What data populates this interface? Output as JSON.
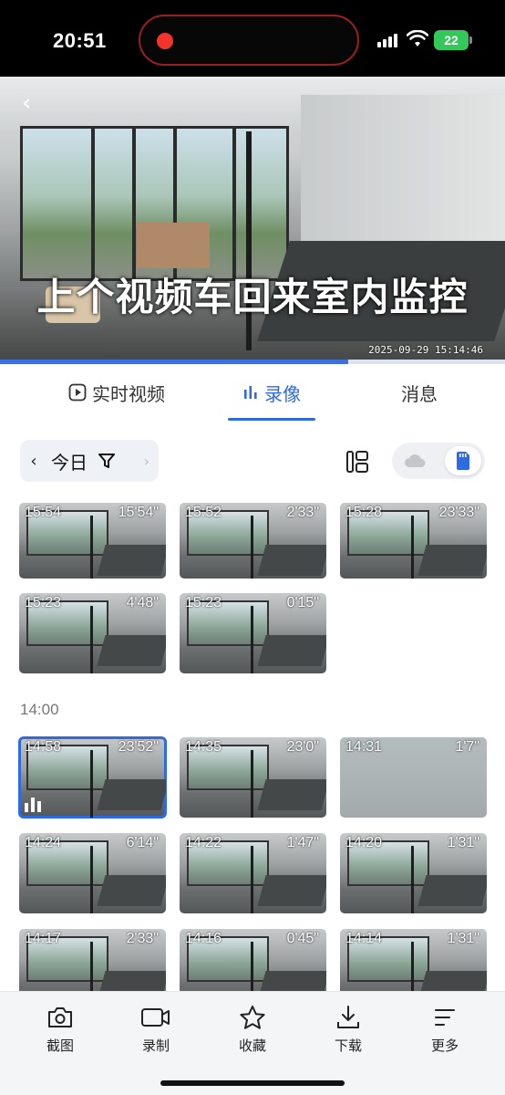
{
  "status_bar": {
    "time": "20:51",
    "battery": "22"
  },
  "video": {
    "overlay_text": "上个视频车回来室内监控",
    "timestamp": "2025-09-29 15:14:46",
    "progress": 0.69
  },
  "tabs": [
    {
      "label": "实时视频",
      "active": false
    },
    {
      "label": "录像",
      "active": true
    },
    {
      "label": "消息",
      "active": false
    }
  ],
  "filter": {
    "date_label": "今日"
  },
  "storage_toggle": {
    "selected": "sd-card"
  },
  "section_label": "14:00",
  "clips_15": [
    {
      "time": "15:54",
      "duration": "15'54\""
    },
    {
      "time": "15:52",
      "duration": "2'33\""
    },
    {
      "time": "15:28",
      "duration": "23'33\""
    },
    {
      "time": "15:23",
      "duration": "4'48\""
    },
    {
      "time": "15:23",
      "duration": "0'15\""
    }
  ],
  "clips_14": [
    {
      "time": "14:58",
      "duration": "23'52\"",
      "selected": true
    },
    {
      "time": "14:35",
      "duration": "23'0\""
    },
    {
      "time": "14:31",
      "duration": "1'7\""
    },
    {
      "time": "14:24",
      "duration": "6'14\""
    },
    {
      "time": "14:22",
      "duration": "1'47\""
    },
    {
      "time": "14:20",
      "duration": "1'31\""
    },
    {
      "time": "14:17",
      "duration": "2'33\""
    },
    {
      "time": "14:16",
      "duration": "0'45\""
    },
    {
      "time": "14:14",
      "duration": "1'31\""
    }
  ],
  "toolbar": {
    "screenshot": "截图",
    "record": "录制",
    "favorite": "收藏",
    "download": "下载",
    "more": "更多"
  }
}
